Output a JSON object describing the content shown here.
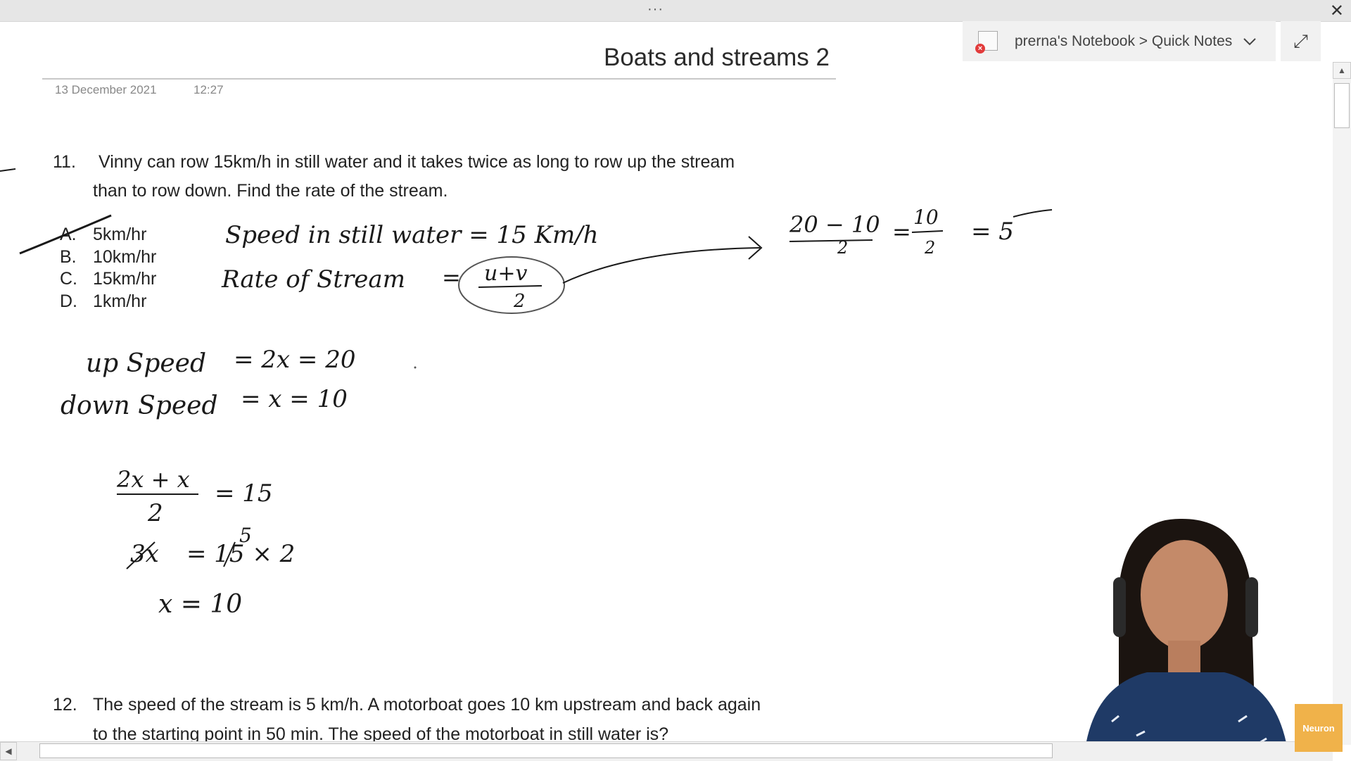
{
  "window": {
    "menu_glyph": "···",
    "close_glyph": "✕"
  },
  "notebook": {
    "path": "prerna's Notebook > Quick Notes",
    "icon": "notebook-sync-error-icon",
    "error_glyph": "×",
    "expand_glyph": "⤢"
  },
  "page": {
    "title": "Boats and streams 2",
    "date": "13 December 2021",
    "time": "12:27"
  },
  "question11": {
    "number": "11.",
    "line1": "Vinny can row 15km/h in still water and it takes twice as long to row up the stream",
    "line2": "than to row down. Find the rate of the stream.",
    "options": [
      {
        "letter": "A.",
        "text": "5km/hr"
      },
      {
        "letter": "B.",
        "text": "10km/hr"
      },
      {
        "letter": "C.",
        "text": "15km/hr"
      },
      {
        "letter": "D.",
        "text": "1km/hr"
      }
    ]
  },
  "ink": {
    "still_speed": "Speed in still water = 15 Km/h",
    "rate_label": "Rate of Stream",
    "eq": "=",
    "formula_num": "u+v",
    "formula_den": "2",
    "calc_num": "20 − 10",
    "calc_den": "2",
    "calc_num2": "10",
    "calc_den2": "2",
    "calc_result": "= 5",
    "up_label": "up Speed",
    "up_eq": "= 2x = 20",
    "down_label": "down Speed",
    "down_eq": "= x = 10",
    "frac_num": "2x + x",
    "frac_den": "2",
    "frac_eq": "= 15",
    "step2_left": "3x",
    "step2_right": "= 15 × 2",
    "step2_cancel_mark": "5",
    "step3": "x = 10"
  },
  "question12": {
    "number": "12.",
    "line1": "The speed of the stream is 5 km/h. A motorboat goes 10 km upstream and back again",
    "line2": "to the starting point in 50 min. The speed of the motorboat in still water is?"
  },
  "scrollbars": {
    "up_glyph": "▲",
    "left_glyph": "◀"
  },
  "logo": {
    "text": "Neuron"
  }
}
